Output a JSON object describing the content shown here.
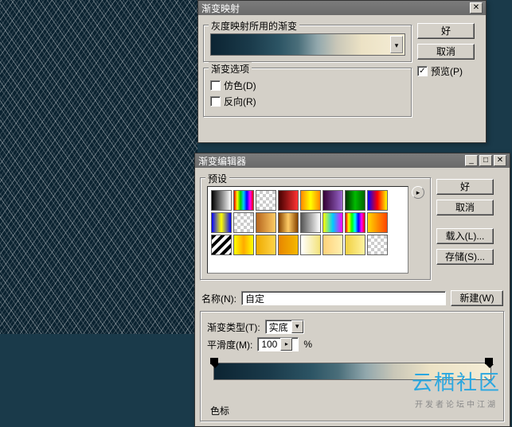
{
  "dialog1": {
    "title": "渐变映射",
    "group1_label": "灰度映射所用的渐变",
    "group2_label": "渐变选项",
    "ok": "好",
    "cancel": "取消",
    "preview": "预览(P)",
    "dither": "仿色(D)",
    "reverse": "反向(R)"
  },
  "dialog2": {
    "title": "渐变编辑器",
    "presets_label": "预设",
    "ok": "好",
    "cancel": "取消",
    "load": "载入(L)...",
    "save": "存储(S)...",
    "name_label": "名称(N):",
    "name_value": "自定",
    "new_btn": "新建(W)",
    "type_label": "渐变类型(T):",
    "type_value": "实底",
    "smooth_label": "平滑度(M):",
    "smooth_value": "100",
    "smooth_unit": "%",
    "stops_label": "色标"
  },
  "watermark": {
    "main": "云栖社区",
    "sub": "开发者论坛中江湖"
  },
  "swatches": [
    "linear-gradient(90deg,#000,#fff)",
    "linear-gradient(90deg,#e00,#ff0,#0c0,#0cf,#00f,#f0f,#e00)",
    "repeating-conic-gradient(#ccc 0 25%,#fff 0 50%) 0 0/8px 8px,linear-gradient(90deg,#000,transparent)",
    "linear-gradient(90deg,#400,#f33)",
    "linear-gradient(90deg,#f80,#ff0,#f80)",
    "linear-gradient(90deg,#303,#96c)",
    "linear-gradient(90deg,#030,#0b0,#060)",
    "linear-gradient(90deg,#00f,#f00,#ff0)",
    "linear-gradient(90deg,#00f,#ff0,#00f)",
    "repeating-conic-gradient(#ccc 0 25%,#fff 0 50%) 0 0/8px 8px,linear-gradient(90deg,transparent,#000)",
    "linear-gradient(90deg,#b5651d,#ffcc66)",
    "linear-gradient(90deg,#840,#fc6,#840)",
    "linear-gradient(90deg,#555,#fff)",
    "linear-gradient(90deg,#ff0,#0cf,#f0f)",
    "linear-gradient(90deg,#f00,#ff0,#0f0,#0ff,#00f,#f0f,#f00)",
    "linear-gradient(90deg,#ffd700,#ff8c00,#ff4500)",
    "repeating-linear-gradient(135deg,#000 0 4px,#fff 4px 8px)",
    "linear-gradient(90deg,#ff0,#fa0,#ff0)",
    "linear-gradient(90deg,#ea0,#ffd54a)",
    "linear-gradient(90deg,#e88600,#f5b800)",
    "linear-gradient(90deg,#fff,#f3e27a)",
    "linear-gradient(90deg,#ffd27a,#fff0b0)",
    "linear-gradient(90deg,#f0d040,#fff3a0)",
    "repeating-conic-gradient(#ccc 0 25%,#fff 0 50%) 0 0/8px 8px"
  ],
  "chart_data": {
    "type": "gradient",
    "title": "自定",
    "colorspace": "RGB hex",
    "stops": [
      {
        "pos": 0.0,
        "color": "#0c2432"
      },
      {
        "pos": 0.2,
        "color": "#1a3a4a"
      },
      {
        "pos": 0.35,
        "color": "#2c5464"
      },
      {
        "pos": 0.45,
        "color": "#4a6e7a"
      },
      {
        "pos": 0.55,
        "color": "#92a8ad"
      },
      {
        "pos": 0.65,
        "color": "#c9c7b8"
      },
      {
        "pos": 0.78,
        "color": "#ece2c5"
      },
      {
        "pos": 1.0,
        "color": "#f5edd6"
      }
    ],
    "opacity_stops": [
      {
        "pos": 0.0,
        "opacity": 1.0
      },
      {
        "pos": 1.0,
        "opacity": 1.0
      }
    ],
    "smoothness_pct": 100,
    "gradient_type": "实底"
  }
}
